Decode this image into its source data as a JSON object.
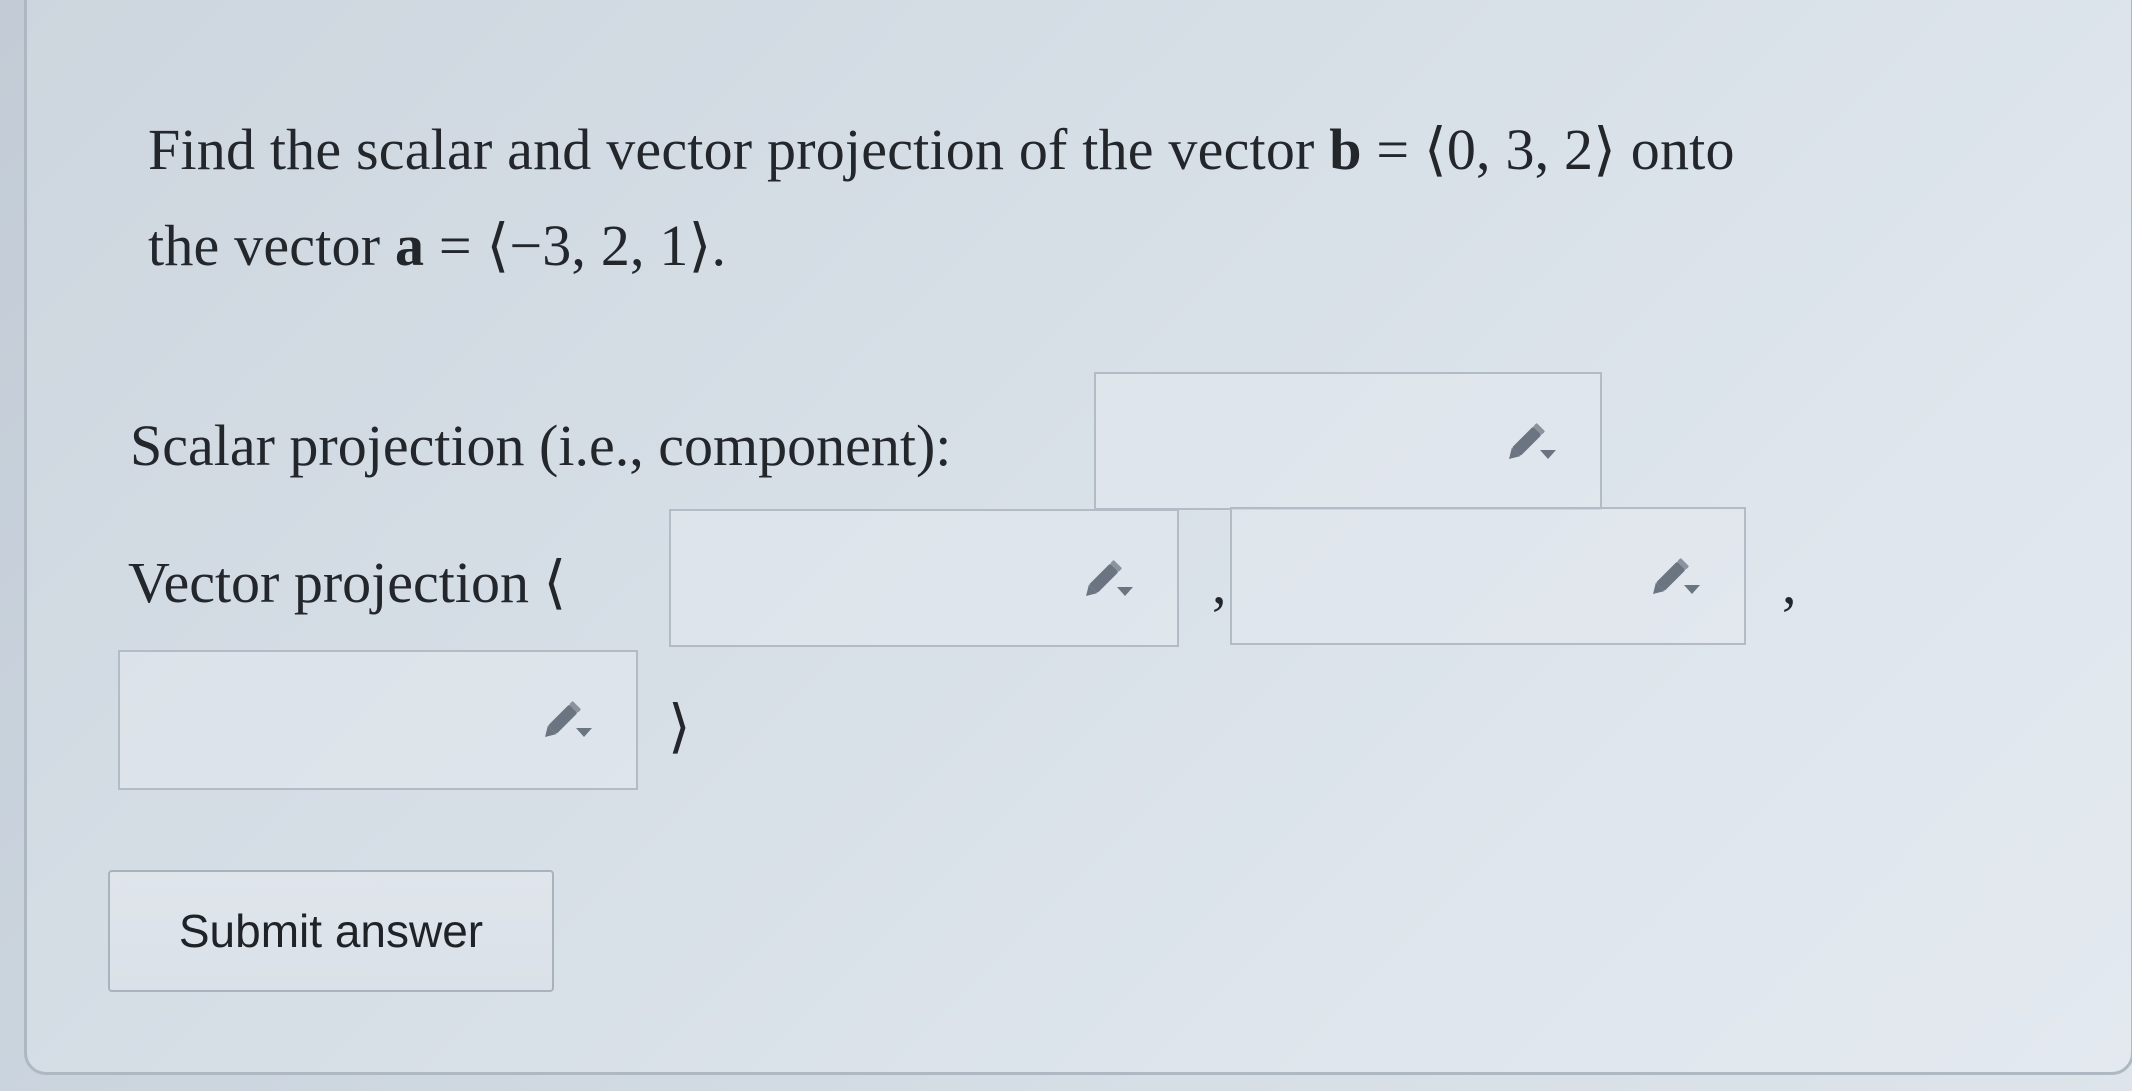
{
  "question": {
    "line1_part1": "Find the scalar and vector projection of the vector ",
    "line1_bold": "b",
    "line1_part2": " = ⟨0, 3, 2⟩ onto",
    "line2_part1": "the vector ",
    "line2_bold": "a",
    "line2_part2": " = ⟨−3, 2, 1⟩."
  },
  "scalar": {
    "label": "Scalar projection (i.e., component):",
    "value": ""
  },
  "vector": {
    "label": "Vector projection ⟨",
    "comp1_value": "",
    "comp2_value": "",
    "comp3_value": "",
    "separator": ",",
    "close_bracket": "⟩"
  },
  "submit": {
    "label": "Submit answer"
  },
  "icons": {
    "input_tool": "pencil-dropdown-icon"
  },
  "colors": {
    "background": "#d7dfe7",
    "border": "#b3bcc6",
    "text": "#23272c",
    "icon": "#6b7582"
  }
}
